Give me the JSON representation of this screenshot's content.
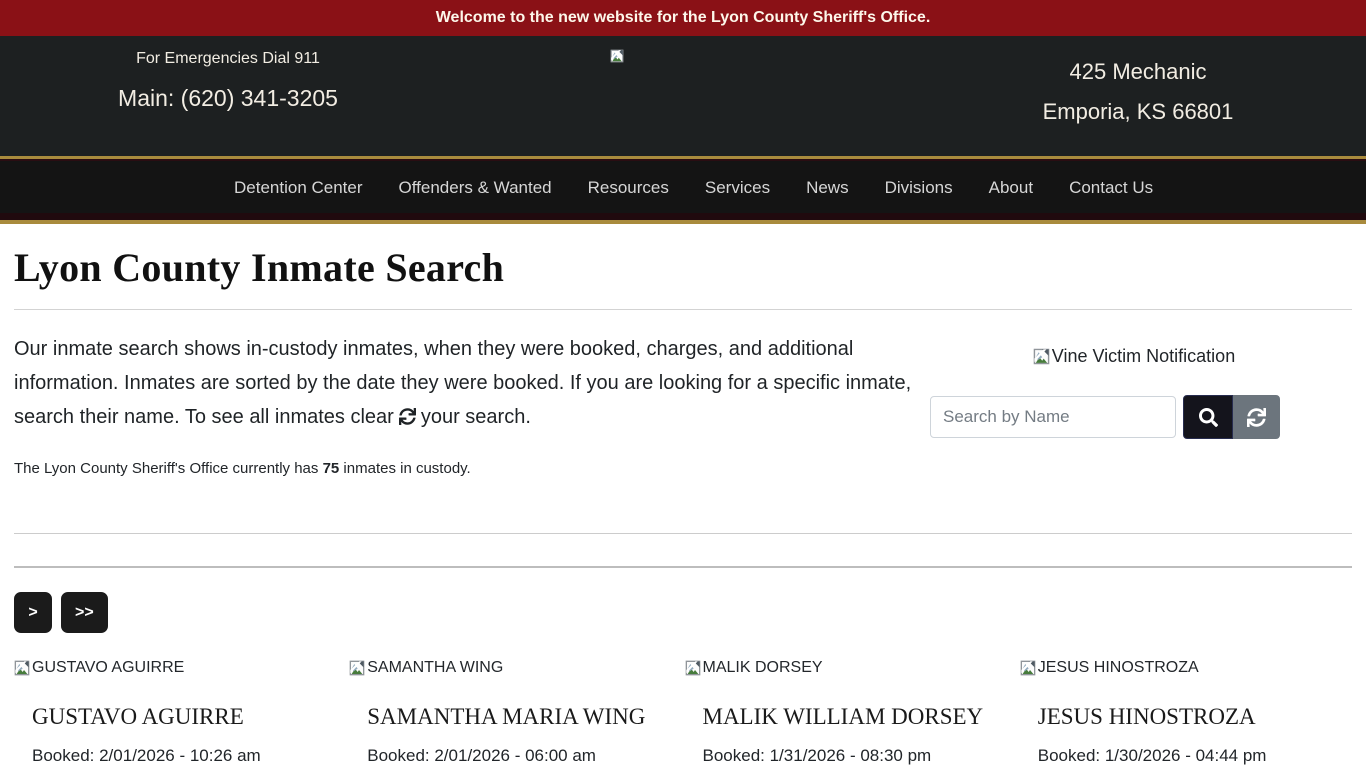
{
  "banner": {
    "text": "Welcome to the new website for the Lyon County Sheriff's Office."
  },
  "header": {
    "emergency": "For Emergencies Dial 911",
    "phone": "Main: (620) 341-3205",
    "address_line1": "425 Mechanic",
    "address_line2": "Emporia, KS 66801"
  },
  "nav": {
    "items": [
      {
        "label": "Detention Center"
      },
      {
        "label": "Offenders & Wanted"
      },
      {
        "label": "Resources"
      },
      {
        "label": "Services"
      },
      {
        "label": "News"
      },
      {
        "label": "Divisions"
      },
      {
        "label": "About"
      },
      {
        "label": "Contact Us"
      }
    ]
  },
  "page": {
    "title": "Lyon County Inmate Search",
    "intro_before": "Our inmate search shows in-custody inmates, when they were booked, charges, and additional information. Inmates are sorted by the date they were booked. If you are looking for a specific inmate, search their name. To see all inmates clear",
    "intro_after": "your search.",
    "custody_before": "The Lyon County Sheriff's Office currently has ",
    "custody_count": "75",
    "custody_after": " inmates in custody."
  },
  "sidebar": {
    "vine_label": "Vine Victim Notification",
    "search_placeholder": "Search by Name"
  },
  "pagination": {
    "next": ">",
    "last": ">>"
  },
  "inmates": [
    {
      "alt": "GUSTAVO AGUIRRE",
      "name": "GUSTAVO AGUIRRE",
      "booked": "Booked: 2/01/2026 - 10:26 am"
    },
    {
      "alt": "SAMANTHA WING",
      "name": "SAMANTHA MARIA WING",
      "booked": "Booked: 2/01/2026 - 06:00 am"
    },
    {
      "alt": "MALIK DORSEY",
      "name": "MALIK WILLIAM DORSEY",
      "booked": "Booked: 1/31/2026 - 08:30 pm"
    },
    {
      "alt": "JESUS HINOSTROZA",
      "name": "JESUS HINOSTROZA",
      "booked": "Booked: 1/30/2026 - 04:44 pm"
    }
  ],
  "icons": {
    "broken_image": "broken-image-icon",
    "search": "magnifier-icon",
    "refresh": "sync-arrows-icon"
  },
  "colors": {
    "banner_red": "#8a1116",
    "gold_trim": "#a98b3d",
    "header_bg": "#1d2021",
    "nav_bg": "#141414",
    "search_button_bg": "#14141c",
    "refresh_button_bg": "#6c757d",
    "page_button_bg": "#1b1b1b"
  }
}
